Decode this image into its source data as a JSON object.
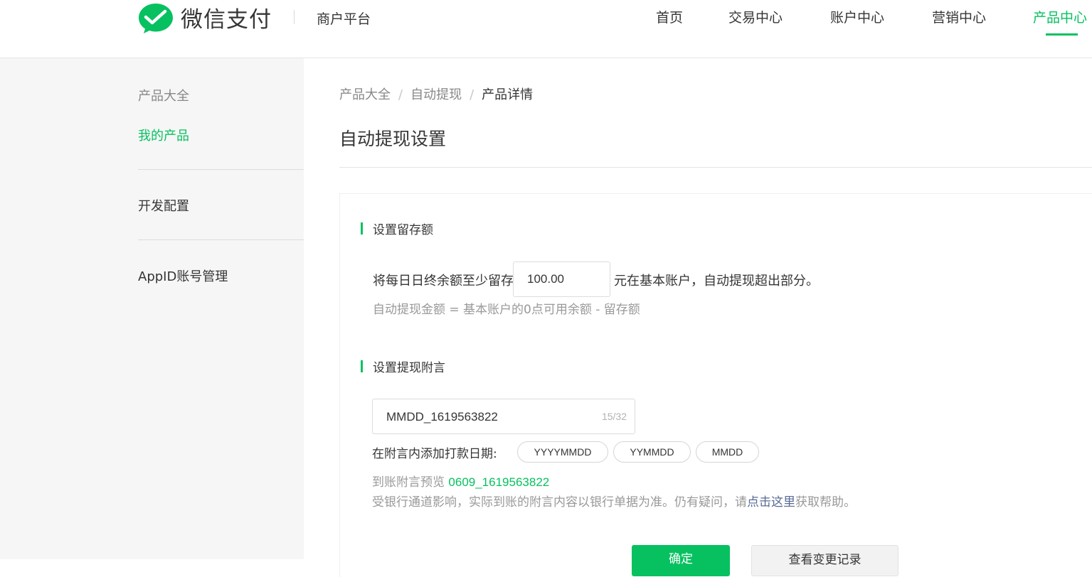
{
  "header": {
    "brand": "微信支付",
    "platform": "商户平台",
    "nav": [
      {
        "label": "首页",
        "active": false
      },
      {
        "label": "交易中心",
        "active": false
      },
      {
        "label": "账户中心",
        "active": false
      },
      {
        "label": "营销中心",
        "active": false
      },
      {
        "label": "产品中心",
        "active": true
      }
    ]
  },
  "sidebar": {
    "section_label": "产品大全",
    "items": [
      {
        "label": "我的产品",
        "active": true
      },
      {
        "label": "开发配置",
        "active": false
      },
      {
        "label": "AppID账号管理",
        "active": false
      }
    ]
  },
  "breadcrumb": [
    "产品大全",
    "自动提现",
    "产品详情"
  ],
  "page_title": "自动提现设置",
  "retain": {
    "section_title": "设置留存额",
    "prefix": "将每日日终余额至少留存",
    "amount": "100.00",
    "suffix": "元在基本账户，自动提现超出部分。",
    "formula": "自动提现金额 = 基本账户的0点可用余额 - 留存额"
  },
  "memo": {
    "section_title": "设置提现附言",
    "value": "MMDD_1619563822",
    "count": "15/32",
    "date_label": "在附言内添加打款日期:",
    "date_options": [
      "YYYYMMDD",
      "YYMMDD",
      "MMDD"
    ],
    "preview_label": "到账附言预览",
    "preview_value": "0609_1619563822",
    "notice_prefix": "受银行通道影响，实际到账的附言内容以银行单据为准。仍有疑问，请",
    "notice_link": "点击这里",
    "notice_suffix": "获取帮助。"
  },
  "actions": {
    "confirm": "确定",
    "history": "查看变更记录"
  },
  "colors": {
    "accent": "#07c160",
    "link": "#576b95"
  }
}
